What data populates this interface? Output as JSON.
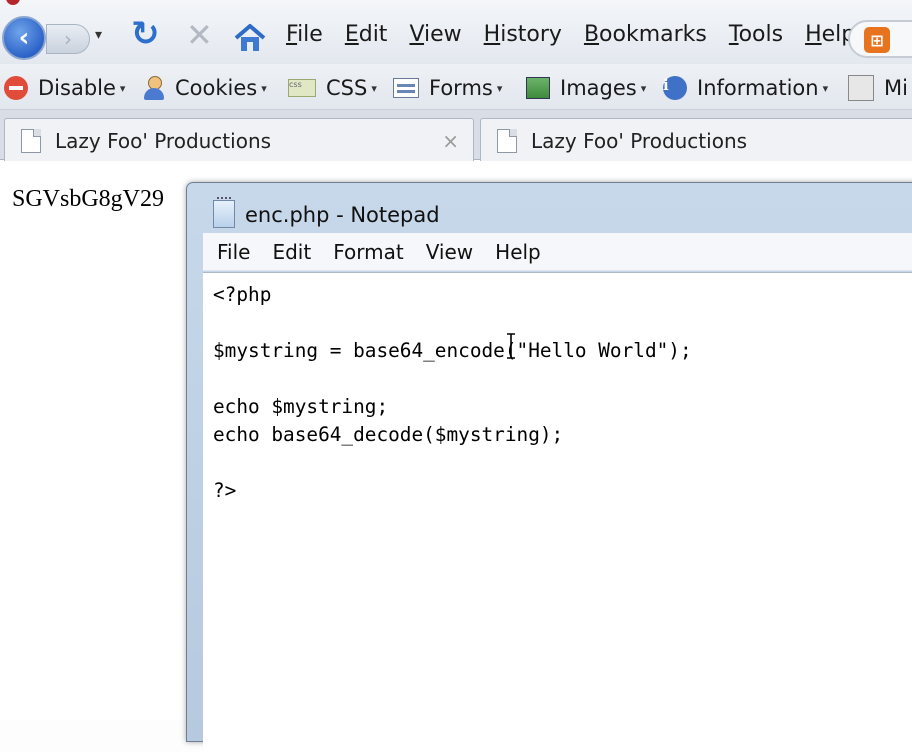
{
  "browser": {
    "menu": [
      "File",
      "Edit",
      "View",
      "History",
      "Bookmarks",
      "Tools",
      "Help"
    ],
    "toolbar": [
      {
        "label": "Disable",
        "icon": "disable-icon"
      },
      {
        "label": "Cookies",
        "icon": "cookies-icon"
      },
      {
        "label": "CSS",
        "icon": "css-icon"
      },
      {
        "label": "Forms",
        "icon": "forms-icon"
      },
      {
        "label": "Images",
        "icon": "images-icon"
      },
      {
        "label": "Information",
        "icon": "information-icon"
      },
      {
        "label": "Mi",
        "icon": "misc-icon"
      }
    ],
    "tabs": [
      {
        "title": "Lazy Foo' Productions"
      },
      {
        "title": "Lazy Foo' Productions"
      }
    ],
    "tab_close_glyph": "×",
    "page_output": "SGVsbG8gV29"
  },
  "notepad": {
    "title": "enc.php - Notepad",
    "menu": [
      "File",
      "Edit",
      "Format",
      "View",
      "Help"
    ],
    "code": "<?php\n\n$mystring = base64_encode(\"Hello World\");\n\necho $mystring;\necho base64_decode($mystring);\n\n?>"
  },
  "colors": {
    "accent_blue": "#2d63c8",
    "disable_red": "#e04b3a",
    "addon_orange": "#e8731f"
  }
}
